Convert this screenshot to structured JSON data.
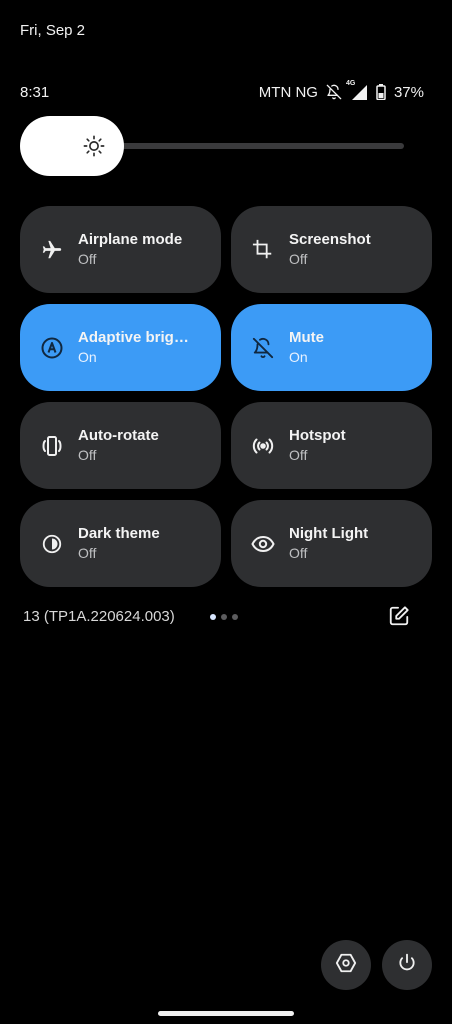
{
  "header": {
    "date": "Fri, Sep 2",
    "time": "8:31",
    "carrier": "MTN NG",
    "battery": "37%",
    "network_badge": "4G",
    "icons": [
      "bell-off-icon",
      "signal-icon",
      "battery-icon"
    ]
  },
  "brightness": {
    "level": 0.27,
    "icon": "brightness-icon"
  },
  "tiles": [
    {
      "label": "Airplane mode",
      "state": "Off",
      "icon": "airplane-icon",
      "active": false
    },
    {
      "label": "Screenshot",
      "state": "Off",
      "icon": "crop-icon",
      "active": false
    },
    {
      "label": "Adaptive bright…",
      "state": "On",
      "icon": "auto-brightness-icon",
      "active": true
    },
    {
      "label": "Mute",
      "state": "On",
      "icon": "bell-off-icon",
      "active": true
    },
    {
      "label": "Auto-rotate",
      "state": "Off",
      "icon": "rotate-icon",
      "active": false
    },
    {
      "label": "Hotspot",
      "state": "Off",
      "icon": "hotspot-icon",
      "active": false
    },
    {
      "label": "Dark theme",
      "state": "Off",
      "icon": "dark-theme-icon",
      "active": false
    },
    {
      "label": "Night Light",
      "state": "Off",
      "icon": "eye-icon",
      "active": false
    }
  ],
  "footer": {
    "build": "13 (TP1A.220624.003)",
    "page_count": 3,
    "current_page": 1
  },
  "colors": {
    "tile_off": "#2e2f31",
    "tile_on": "#3c9bf6",
    "background": "#000000"
  }
}
